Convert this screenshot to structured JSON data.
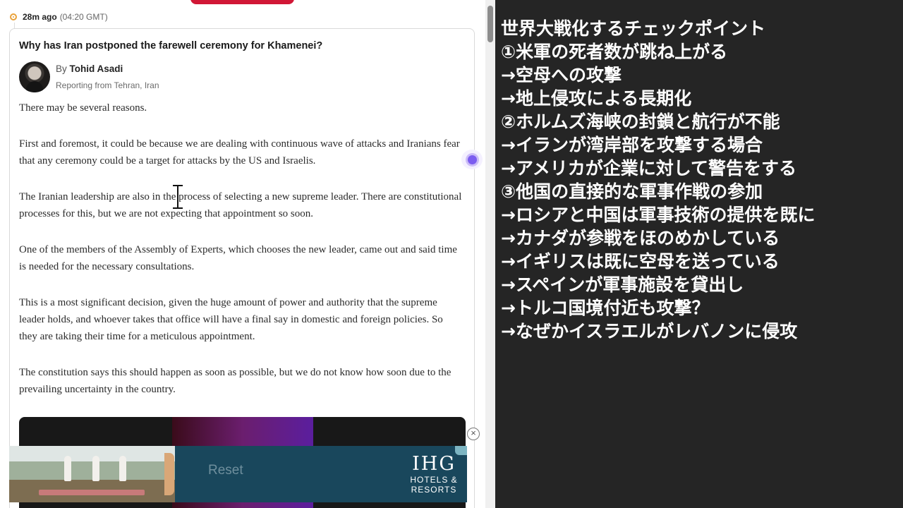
{
  "feed": {
    "time_ago": "28m ago",
    "time_gmt": "(04:20 GMT)"
  },
  "article": {
    "headline": "Why has Iran postponed the farewell ceremony for Khamenei?",
    "by_prefix": "By",
    "author": "Tohid Asadi",
    "location": "Reporting from Tehran, Iran",
    "paragraphs": [
      "There may be several reasons.",
      "First and foremost, it could be because we are dealing with continuous wave of attacks and Iranians fear that any ceremony could be a target for attacks by the US and Israelis.",
      "The Iranian leadership are also in the process of selecting a new supreme leader. There are constitutional processes for this, but we are not expecting that appointment so soon.",
      "One of the members of the Assembly of Experts, which chooses the new leader, came out and said time is needed for the necessary consultations.",
      "This is a most significant decision, given the huge amount of power and authority that the supreme leader holds, and whoever takes that office will have a final say in domestic and foreign policies. So they are taking their time for a meticulous appointment.",
      "The constitution says this should happen as soon as possible, but we do not know how soon due to the prevailing uncertainty in the country."
    ]
  },
  "ad": {
    "button_label": "Reset",
    "brand": "IHG",
    "brand_line1": "HOTELS &",
    "brand_line2": "RESORTS",
    "close_glyph": "×"
  },
  "notes": {
    "lines": [
      "世界大戦化するチェックポイント",
      "①米軍の死者数が跳ね上がる",
      "→空母への攻撃",
      "→地上侵攻による長期化",
      "②ホルムズ海峡の封鎖と航行が不能",
      "→イランが湾岸部を攻撃する場合",
      "→アメリカが企業に対して警告をする",
      "③他国の直接的な軍事作戦の参加",
      "→ロシアと中国は軍事技術の提供を既に",
      "→カナダが参戦をほのめかしている",
      "→イギリスは既に空母を送っている",
      "→スペインが軍事施設を貸出し",
      "→トルコ国境付近も攻撃？",
      "→なぜかイスラエルがレバノンに侵攻"
    ]
  },
  "icons": {
    "status_dot": "live-dot-icon",
    "assistant": "ai-assistant-icon",
    "cursor": "text-cursor-icon"
  },
  "colors": {
    "accent_red": "#d11736",
    "live_dot": "#e9a23b",
    "notes_bg": "#252525",
    "ad_bg": "#19475c"
  }
}
